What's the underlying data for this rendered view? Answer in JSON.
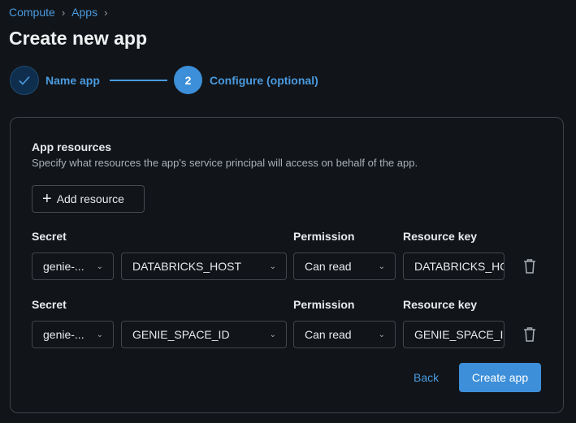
{
  "breadcrumb": [
    "Compute",
    "Apps"
  ],
  "title": "Create new app",
  "steps": [
    {
      "label": "Name app",
      "state": "done"
    },
    {
      "number": "2",
      "label": "Configure (optional)",
      "state": "active"
    }
  ],
  "section": {
    "title": "App resources",
    "description": "Specify what resources the app's service principal will access on behalf of the app.",
    "add_label": "Add resource"
  },
  "rows": [
    {
      "type_label": "Secret",
      "permission_label": "Permission",
      "key_label": "Resource key",
      "scope": "genie-...",
      "secret": "DATABRICKS_HOST",
      "permission": "Can read",
      "key": "DATABRICKS_HOST"
    },
    {
      "type_label": "Secret",
      "permission_label": "Permission",
      "key_label": "Resource key",
      "scope": "genie-...",
      "secret": "GENIE_SPACE_ID",
      "permission": "Can read",
      "key": "GENIE_SPACE_ID"
    }
  ],
  "actions": {
    "back": "Back",
    "create": "Create app"
  },
  "colors": {
    "accent": "#3d8fd9",
    "background": "#111418"
  }
}
